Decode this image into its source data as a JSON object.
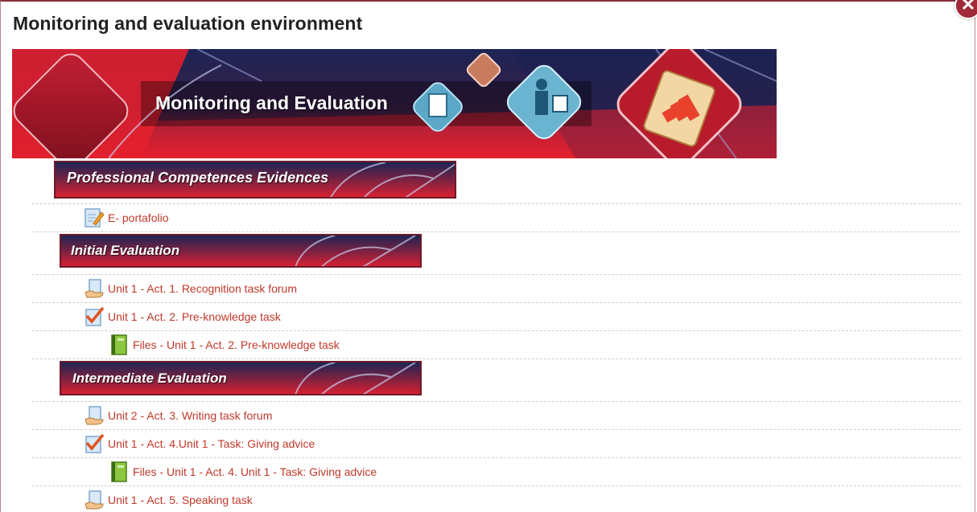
{
  "window": {
    "close_symbol": "✕",
    "title": "Monitoring and evaluation environment"
  },
  "hero": {
    "text": "Monitoring and Evaluation",
    "colors": {
      "bg_dark": "#1d2453",
      "bg_red": "#e8202e"
    }
  },
  "sections": [
    {
      "banner": "Professional Competences Evidences",
      "items": [
        {
          "label": "E- portafolio",
          "icon": "pencil-page-icon",
          "indent": 1
        }
      ]
    },
    {
      "banner": "Initial Evaluation",
      "items": [
        {
          "label": "Unit 1 - Act. 1. Recognition task forum",
          "icon": "forum-icon",
          "indent": 1
        },
        {
          "label": "Unit 1 - Act. 2. Pre-knowledge task",
          "icon": "assignment-check-icon",
          "indent": 1
        },
        {
          "label": "Files - Unit 1 - Act. 2. Pre-knowledge task",
          "icon": "book-icon",
          "indent": 2
        }
      ]
    },
    {
      "banner": "Intermediate Evaluation",
      "items": [
        {
          "label": "Unit 2 - Act. 3. Writing task forum",
          "icon": "forum-icon",
          "indent": 1
        },
        {
          "label": "Unit 1 - Act. 4.Unit 1 - Task: Giving advice",
          "icon": "assignment-check-icon",
          "indent": 1
        },
        {
          "label": "Files - Unit 1 - Act. 4. Unit 1 - Task: Giving advice",
          "icon": "book-icon",
          "indent": 2
        },
        {
          "label": "Unit 1 - Act. 5. Speaking task",
          "icon": "forum-icon",
          "indent": 1
        }
      ]
    }
  ],
  "colors": {
    "link": "#c0392b",
    "accent": "#8b2d3e",
    "banner_dark": "#1d2453",
    "banner_red": "#e8202e"
  }
}
